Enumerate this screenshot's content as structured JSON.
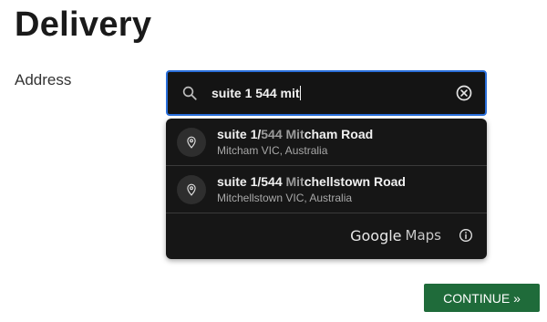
{
  "page": {
    "title": "Delivery",
    "address_label": "Address"
  },
  "search": {
    "value": "suite 1 544 mit",
    "icon": "search-icon",
    "clear_icon": "clear-icon"
  },
  "suggestions": [
    {
      "main_parts": [
        "suite 1/",
        "544",
        " ",
        "Mit",
        "cham Road"
      ],
      "secondary": "Mitcham VIC, Australia",
      "icon": "map-pin-icon"
    },
    {
      "main_parts": [
        "suite 1/544 ",
        "",
        "",
        "Mit",
        "chellstown Road"
      ],
      "secondary": "Mitchellstown VIC, Australia",
      "icon": "map-pin-icon"
    }
  ],
  "attribution": {
    "google": "Google",
    "maps": "Maps",
    "info_icon": "info-icon"
  },
  "actions": {
    "continue_label": "CONTINUE »"
  },
  "colors": {
    "input_border": "#2a6fdb",
    "dropdown_bg": "#161616",
    "continue_bg": "#1f6b3a"
  }
}
